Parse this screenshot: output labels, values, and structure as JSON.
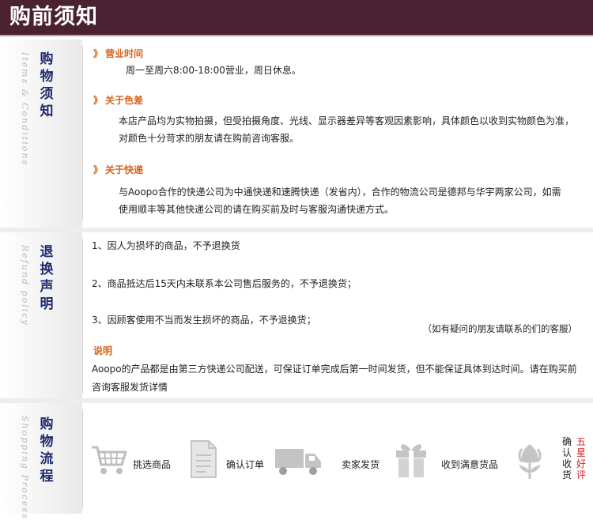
{
  "header": {
    "title": "购前须知"
  },
  "sections": {
    "notice": {
      "side_title": "购物须知",
      "side_script": "Items & Conditions",
      "business_hours": {
        "title": "营业时间",
        "text": "周一至周六8:00-18:00营业，周日休息。"
      },
      "color": {
        "title": "关于色差",
        "line1": "本店产品均为实物拍摄，但受拍摄角度、光线、显示器差异等客观因素影响，具体颜色以收到实物颜色为准，",
        "line2": "对颜色十分苛求的朋友请在购前咨询客服。"
      },
      "shipping": {
        "title": "关于快递",
        "line1": "与Aoopo合作的快递公司为中通快递和速腾快递（发省内），合作的物流公司是德邦与华宇两家公司，如需",
        "line2": "使用顺丰等其他快递公司的请在购买前及时与客服沟通快递方式。"
      }
    },
    "returns": {
      "side_title": "退换声明",
      "side_script": "Refund policy",
      "items": [
        "1、因人为损坏的商品，不予退换货",
        "2、商品抵达后15天内未联系本公司售后服务的，不予退换货；",
        "3、因顾客使用不当而发生损坏的商品，不予退换货；"
      ],
      "consult_note": "（如有疑问的朋友请联系的们的客服）",
      "explain": {
        "title": "说明",
        "line1": "Aoopo的产品都是由第三方快递公司配送，可保证订单完成后第一时间发货，但不能保证具体到达时间。请在购买前",
        "line2": "咨询客服发货详情"
      }
    },
    "process": {
      "side_title": "购物流程",
      "side_script": "Shopping Process",
      "steps": [
        {
          "label": "挑选商品",
          "icon": "cart-icon"
        },
        {
          "label": "确认订单",
          "icon": "document-icon"
        },
        {
          "label": "卖家发货",
          "icon": "truck-icon"
        },
        {
          "label": "收到满意货品",
          "icon": "gift-icon"
        }
      ],
      "confirm_label": [
        "确",
        "认",
        "收",
        "货"
      ],
      "review_label": [
        "五",
        "星",
        "好",
        "评"
      ],
      "colors": {
        "icon": "#bdbdbd",
        "review": "#d6262a"
      }
    }
  }
}
